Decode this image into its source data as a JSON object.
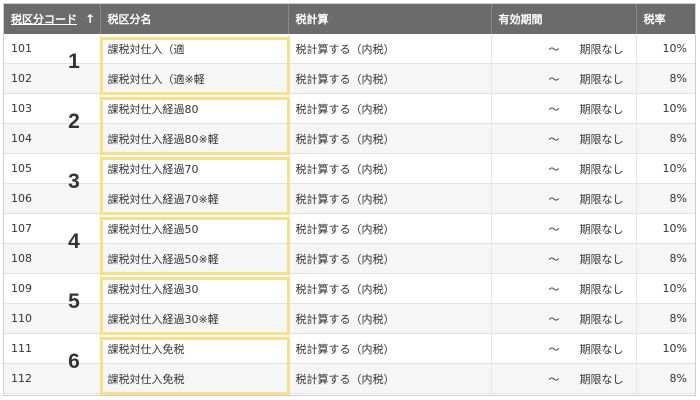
{
  "table": {
    "columns": [
      {
        "label": "税区分コード",
        "sort_icon": "arrow-up-icon"
      },
      {
        "label": "税区分名"
      },
      {
        "label": "税計算"
      },
      {
        "label": "有効期間"
      },
      {
        "label": "税率"
      }
    ],
    "rows": [
      {
        "code": "101",
        "name": "課税対仕入（適",
        "calc": "税計算する（内税）",
        "period_sep": "～",
        "period": "期限なし",
        "rate": "10%"
      },
      {
        "code": "102",
        "name": "課税対仕入（適※軽",
        "calc": "税計算する（内税）",
        "period_sep": "～",
        "period": "期限なし",
        "rate": "8%"
      },
      {
        "code": "103",
        "name": "課税対仕入経過80",
        "calc": "税計算する（内税）",
        "period_sep": "～",
        "period": "期限なし",
        "rate": "10%"
      },
      {
        "code": "104",
        "name": "課税対仕入経過80※軽",
        "calc": "税計算する（内税）",
        "period_sep": "～",
        "period": "期限なし",
        "rate": "8%"
      },
      {
        "code": "105",
        "name": "課税対仕入経過70",
        "calc": "税計算する（内税）",
        "period_sep": "～",
        "period": "期限なし",
        "rate": "10%"
      },
      {
        "code": "106",
        "name": "課税対仕入経過70※軽",
        "calc": "税計算する（内税）",
        "period_sep": "～",
        "period": "期限なし",
        "rate": "8%"
      },
      {
        "code": "107",
        "name": "課税対仕入経過50",
        "calc": "税計算する（内税）",
        "period_sep": "～",
        "period": "期限なし",
        "rate": "10%"
      },
      {
        "code": "108",
        "name": "課税対仕入経過50※軽",
        "calc": "税計算する（内税）",
        "period_sep": "～",
        "period": "期限なし",
        "rate": "8%"
      },
      {
        "code": "109",
        "name": "課税対仕入経過30",
        "calc": "税計算する（内税）",
        "period_sep": "～",
        "period": "期限なし",
        "rate": "10%"
      },
      {
        "code": "110",
        "name": "課税対仕入経過30※軽",
        "calc": "税計算する（内税）",
        "period_sep": "～",
        "period": "期限なし",
        "rate": "8%"
      },
      {
        "code": "111",
        "name": "課税対仕入免税",
        "calc": "税計算する（内税）",
        "period_sep": "～",
        "period": "期限なし",
        "rate": "10%"
      },
      {
        "code": "112",
        "name": "課税対仕入免税",
        "calc": "税計算する（内税）",
        "period_sep": "～",
        "period": "期限なし",
        "rate": "8%"
      }
    ]
  },
  "annotations": {
    "groups": [
      "1",
      "2",
      "3",
      "4",
      "5",
      "6"
    ],
    "highlight_color": "#f7e08a"
  }
}
